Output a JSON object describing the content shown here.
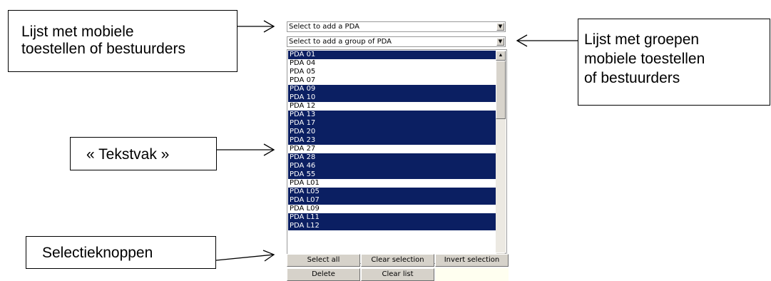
{
  "callouts": {
    "devices": "Lijst met mobiele\ntoestellen of bestuurders",
    "groups": "Lijst met groepen\nmobiele toestellen\nof bestuurders",
    "textbox": "« Tekstvak »",
    "buttons": "Selectieknoppen"
  },
  "ui": {
    "device_select": {
      "value": "Select to add a PDA"
    },
    "group_select": {
      "value": "Select to add a group of PDA"
    },
    "list_items": [
      {
        "label": "PDA 01",
        "selected": true
      },
      {
        "label": "PDA 04",
        "selected": false
      },
      {
        "label": "PDA 05",
        "selected": false
      },
      {
        "label": "PDA 07",
        "selected": false
      },
      {
        "label": "PDA 09",
        "selected": true
      },
      {
        "label": "PDA 10",
        "selected": true
      },
      {
        "label": "PDA 12",
        "selected": false
      },
      {
        "label": "PDA 13",
        "selected": true
      },
      {
        "label": "PDA 17",
        "selected": true
      },
      {
        "label": "PDA 20",
        "selected": true
      },
      {
        "label": "PDA 23",
        "selected": true
      },
      {
        "label": "PDA 27",
        "selected": false
      },
      {
        "label": "PDA 28",
        "selected": true
      },
      {
        "label": "PDA 46",
        "selected": true
      },
      {
        "label": "PDA 55",
        "selected": true
      },
      {
        "label": "PDA L01",
        "selected": false
      },
      {
        "label": "PDA L05",
        "selected": true
      },
      {
        "label": "PDA L07",
        "selected": true
      },
      {
        "label": "PDA L09",
        "selected": false
      },
      {
        "label": "PDA L11",
        "selected": true
      },
      {
        "label": "PDA L12",
        "selected": true
      }
    ],
    "buttons": {
      "select_all": "Select all",
      "clear_selection": "Clear selection",
      "invert_selection": "Invert selection",
      "delete": "Delete",
      "clear_list": "Clear list"
    }
  },
  "colors": {
    "selection": "#0b1f62",
    "button_face": "#d6d2ca",
    "filler": "#fffff0"
  }
}
